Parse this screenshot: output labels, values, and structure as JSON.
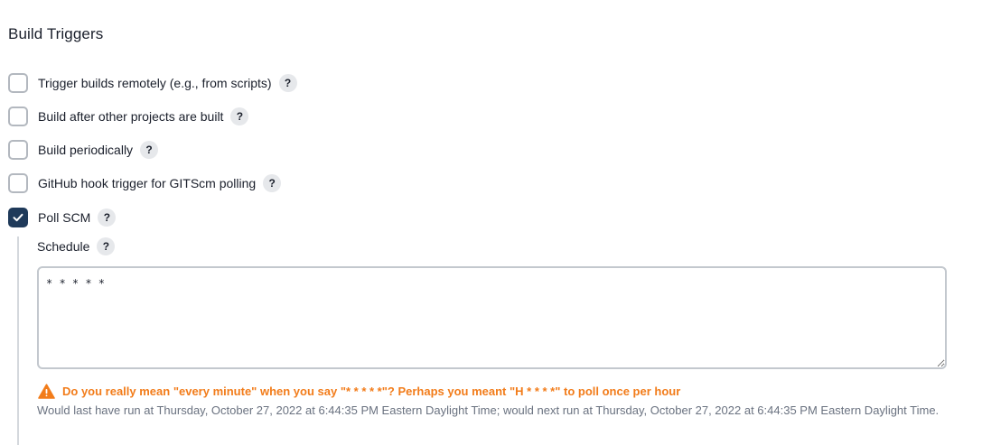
{
  "section": {
    "title": "Build Triggers"
  },
  "triggers": [
    {
      "label": "Trigger builds remotely (e.g., from scripts)",
      "checked": false,
      "help": "?"
    },
    {
      "label": "Build after other projects are built",
      "checked": false,
      "help": "?"
    },
    {
      "label": "Build periodically",
      "checked": false,
      "help": "?"
    },
    {
      "label": "GitHub hook trigger for GITScm polling",
      "checked": false,
      "help": "?"
    },
    {
      "label": "Poll SCM",
      "checked": true,
      "help": "?"
    }
  ],
  "poll_scm": {
    "schedule_label": "Schedule",
    "schedule_help": "?",
    "schedule_value": "* * * * *",
    "warning": "Do you really mean \"every minute\" when you say \"* * * * *\"? Perhaps you meant \"H * * * *\" to poll once per hour",
    "info": "Would last have run at Thursday, October 27, 2022 at 6:44:35 PM Eastern Daylight Time; would next run at Thursday, October 27, 2022 at 6:44:35 PM Eastern Daylight Time."
  },
  "colors": {
    "checked_bg": "#1f3a5a",
    "warning": "#f27c1a",
    "info": "#6a7280"
  },
  "icons": {
    "checkbox_check": "check-icon",
    "warning": "warning-triangle-icon",
    "help": "help-icon"
  }
}
